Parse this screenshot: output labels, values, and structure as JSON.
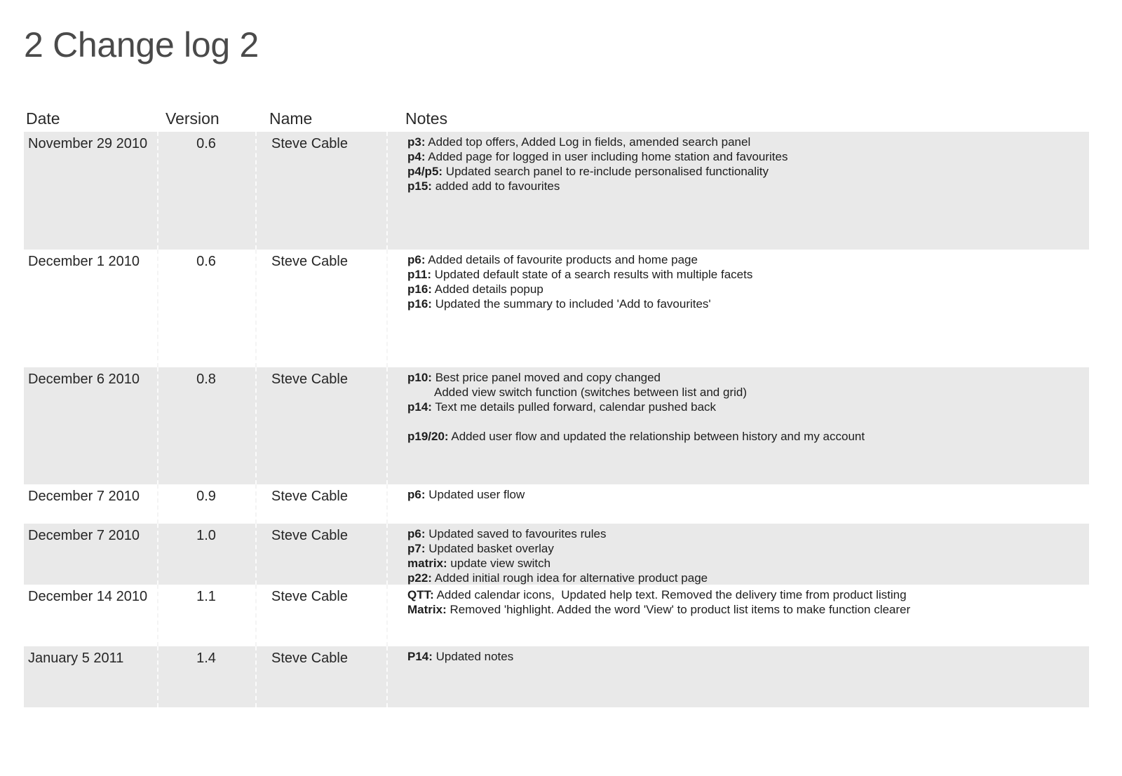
{
  "page": {
    "title": "2 Change log 2"
  },
  "table": {
    "columns": [
      "Date",
      "Version",
      "Name",
      "Notes"
    ],
    "rows": [
      {
        "date": "November 29 2010",
        "version": "0.6",
        "name": "Steve Cable",
        "notes": [
          {
            "tag": "p3:",
            "text": " Added top offers, Added Log in fields, amended search panel"
          },
          {
            "tag": "p4:",
            "text": " Added page for logged in user including home station and favourites"
          },
          {
            "tag": "p4/p5:",
            "text": " Updated search panel to re-include personalised functionality"
          },
          {
            "tag": "p15:",
            "text": " added add to favourites"
          }
        ]
      },
      {
        "date": "December 1 2010",
        "version": "0.6",
        "name": "Steve Cable",
        "notes": [
          {
            "tag": "p6:",
            "text": " Added details of favourite products and home page"
          },
          {
            "tag": "p11:",
            "text": " Updated default state of a search results with multiple facets"
          },
          {
            "tag": "p16:",
            "text": " Added details popup"
          },
          {
            "tag": "p16:",
            "text": " Updated the summary to included 'Add to favourites'"
          }
        ]
      },
      {
        "date": "December 6 2010",
        "version": "0.8",
        "name": "Steve Cable",
        "notes": [
          {
            "tag": "p10:",
            "text": " Best price panel moved and copy changed"
          },
          {
            "tag": "",
            "text": "Added view switch function (switches between list and grid)",
            "indent": true
          },
          {
            "tag": "p14:",
            "text": " Text me details pulled forward, calendar pushed back"
          },
          {
            "tag": "",
            "text": ""
          },
          {
            "tag": "p19/20:",
            "text": " Added user flow and updated the relationship between history and my account"
          }
        ]
      },
      {
        "date": "December 7 2010",
        "version": "0.9",
        "name": "Steve Cable",
        "notes": [
          {
            "tag": "p6:",
            "text": " Updated user flow"
          }
        ]
      },
      {
        "date": "December 7 2010",
        "version": "1.0",
        "name": "Steve Cable",
        "notes": [
          {
            "tag": "p6:",
            "text": " Updated saved to favourites rules"
          },
          {
            "tag": "p7:",
            "text": " Updated basket overlay"
          },
          {
            "tag": "matrix:",
            "text": " update view switch"
          },
          {
            "tag": "p22:",
            "text": " Added initial rough idea for alternative product page"
          }
        ]
      },
      {
        "date": "December 14 2010",
        "version": "1.1",
        "name": "Steve Cable",
        "notes": [
          {
            "tag": "QTT:",
            "text": " Added calendar icons,  Updated help text. Removed the delivery time from product listing"
          },
          {
            "tag": "Matrix:",
            "text": " Removed 'highlight. Added the word 'View' to product list items to make function clearer"
          }
        ]
      },
      {
        "date": "January 5 2011",
        "version": "1.4",
        "name": "Steve Cable",
        "notes": [
          {
            "tag": "P14:",
            "text": " Updated notes"
          }
        ]
      }
    ]
  },
  "colors": {
    "row_shade": "#e9e9e9",
    "title_text": "#4a4a4a",
    "body_text": "#222222"
  }
}
